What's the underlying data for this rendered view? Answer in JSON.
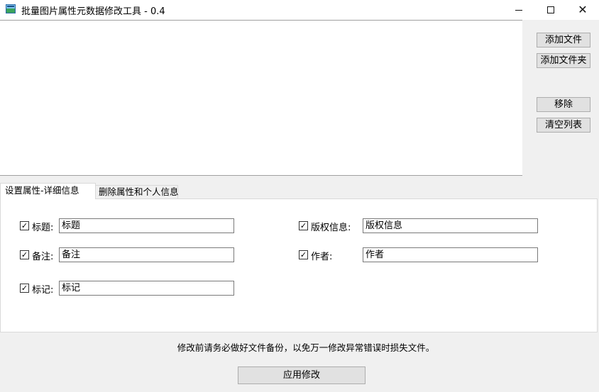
{
  "window": {
    "title": "批量图片属性元数据修改工具 - 0.4",
    "icon": "app-icon",
    "controls": {
      "minimize": "minimize-icon",
      "maximize": "maximize-icon",
      "close": "✕"
    }
  },
  "file_list": {
    "items": []
  },
  "side_buttons": {
    "add_file": "添加文件",
    "add_folder": "添加文件夹",
    "remove": "移除",
    "clear_list": "清空列表"
  },
  "tabs": [
    {
      "label": "设置属性-详细信息",
      "active": true
    },
    {
      "label": "删除属性和个人信息",
      "active": false
    }
  ],
  "fields": {
    "title": {
      "label": "标题:",
      "value": "标题",
      "checked": true
    },
    "copyright": {
      "label": "版权信息:",
      "value": "版权信息",
      "checked": true
    },
    "comment": {
      "label": "备注:",
      "value": "备注",
      "checked": true
    },
    "author": {
      "label": "作者:",
      "value": "作者",
      "checked": true
    },
    "tags": {
      "label": "标记:",
      "value": "标记",
      "checked": true
    }
  },
  "checkmark": "✓",
  "footer": {
    "warning": "修改前请务必做好文件备份，以免万一修改异常错误时损失文件。",
    "apply_button": "应用修改"
  }
}
